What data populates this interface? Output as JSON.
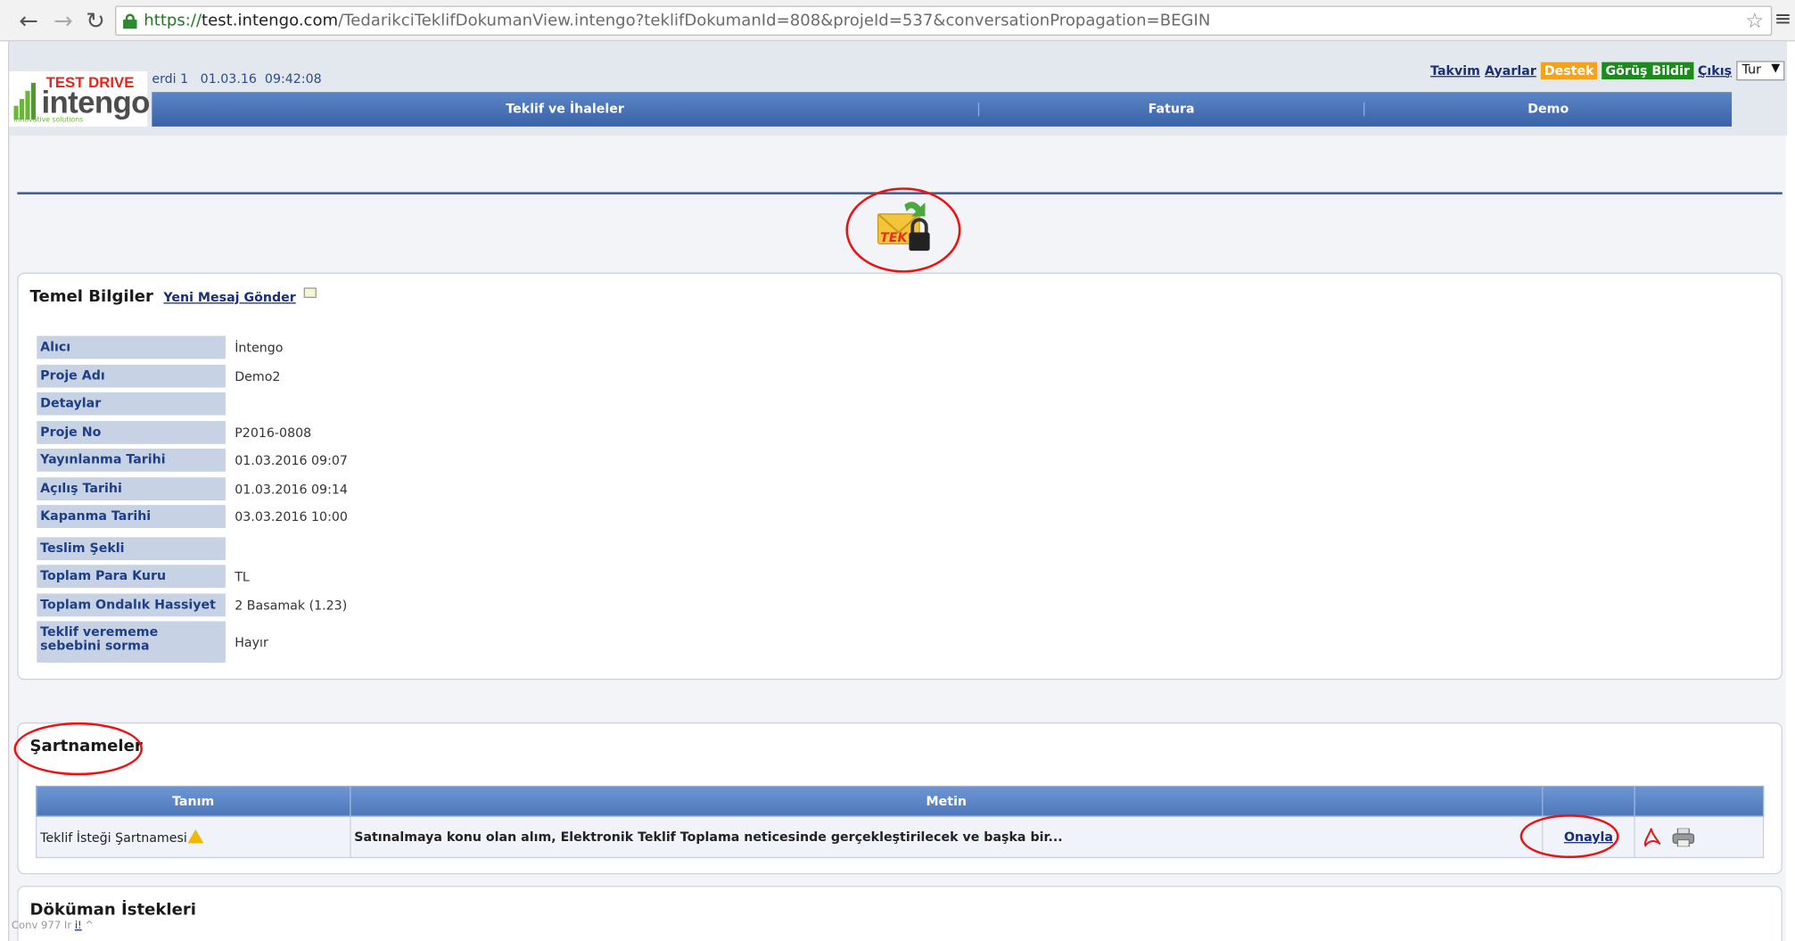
{
  "browser": {
    "url_scheme": "https://",
    "url_host": "test.intengo.com",
    "url_path": "/TedarikciTeklifDokumanView.intengo?teklifDokumanId=808&projeId=537&conversationPropagation=BEGIN"
  },
  "header": {
    "logo_badge": "TEST DRIVE",
    "logo_word": "intengo",
    "logo_sub": "innovative solutions",
    "user_info": "erdi 1   01.03.16  09:42:08",
    "links": {
      "takvim": "Takvim",
      "ayarlar": "Ayarlar",
      "destek": "Destek",
      "gorus": "Görüş Bildir",
      "cikis": "Çıkış",
      "language": "Tur"
    },
    "nav": [
      "Teklif ve İhaleler",
      "Fatura",
      "Demo"
    ]
  },
  "temel": {
    "title": "Temel Bilgiler",
    "new_message": "Yeni Mesaj Gönder",
    "rows": [
      {
        "label": "Alıcı",
        "value": "İntengo"
      },
      {
        "label": "Proje Adı",
        "value": "Demo2"
      },
      {
        "label": "Detaylar",
        "value": ""
      },
      {
        "label": "Proje No",
        "value": "P2016-0808"
      },
      {
        "label": "Yayınlanma Tarihi",
        "value": "01.03.2016 09:07"
      },
      {
        "label": "Açılış Tarihi",
        "value": "01.03.2016 09:14"
      },
      {
        "label": "Kapanma Tarihi",
        "value": "03.03.2016 10:00"
      },
      {
        "label": "Teslim Şekli",
        "value": ""
      },
      {
        "label": "Toplam Para Kuru",
        "value": "TL"
      },
      {
        "label": "Toplam Ondalık Hassiyet",
        "value": "2 Basamak (1.23)"
      },
      {
        "label": "Teklif verememe sebebini sorma",
        "value": "Hayır"
      }
    ]
  },
  "sartnameler": {
    "title": "Şartnameler",
    "columns": [
      "Tanım",
      "Metin",
      "",
      ""
    ],
    "row": {
      "tanim": "Teklif İsteği Şartnamesi",
      "metin": "Satınalmaya konu olan alım, Elektronik Teklif Toplama neticesinde gerçekleştirilecek ve başka bir...",
      "action": "Onayla"
    }
  },
  "dokuman": {
    "title": "Döküman İstekleri"
  },
  "debug_bar": "Conv 977 Ir",
  "colors": {
    "nav_blue": "#3a62a8",
    "label_bg": "#c7d3e5",
    "destek": "#f7a21b",
    "gorus": "#1c8a1c",
    "annotation_red": "#e11111"
  }
}
